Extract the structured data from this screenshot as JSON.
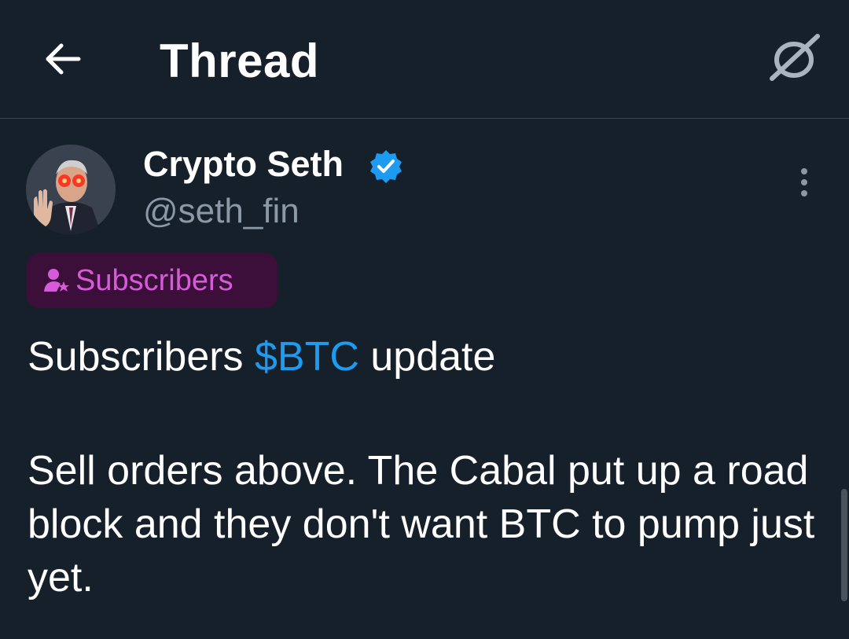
{
  "header": {
    "title": "Thread",
    "back_icon": "arrow-left-icon",
    "sparkle_icon": "timeline-sparkle-icon"
  },
  "tweet": {
    "author": {
      "name": "Crypto Seth",
      "handle": "@seth_fin",
      "verified": true,
      "verified_color": "#1d9bf0"
    },
    "badge": {
      "label": "Subscribers",
      "icon": "subscriber-star-icon",
      "text_color": "#d55bd9",
      "background": "#3c0f3a"
    },
    "text": {
      "line1_prefix": "Subscribers ",
      "cashtag": "$BTC",
      "line1_suffix": " update",
      "line2": "Sell orders above. The Cabal put up a road block and they don't want BTC to pump just yet."
    }
  },
  "colors": {
    "background": "#15202b",
    "divider": "#38444d",
    "secondary_text": "#8b98a5",
    "link": "#1d9bf0"
  }
}
